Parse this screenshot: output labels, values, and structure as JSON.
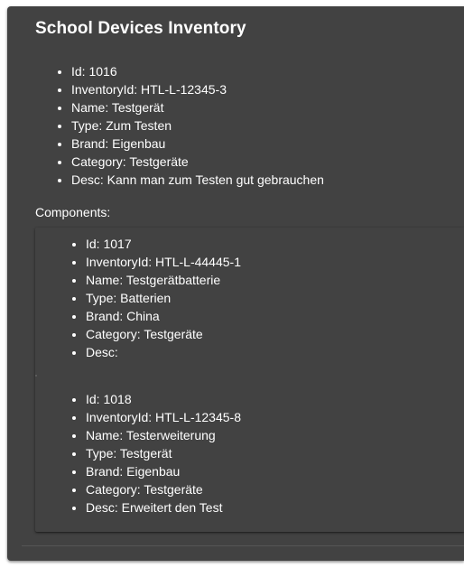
{
  "title": "School Devices Inventory",
  "device": {
    "fields": [
      "Id: 1016",
      "InventoryId: HTL-L-12345-3",
      "Name: Testgerät",
      "Type: Zum Testen",
      "Brand: Eigenbau",
      "Category: Testgeräte",
      "Desc: Kann man zum Testen gut gebrauchen"
    ]
  },
  "components_label": "Components:",
  "components": [
    {
      "fields": [
        "Id: 1017",
        "InventoryId: HTL-L-44445-1",
        "Name: Testgerätbatterie",
        "Type: Batterien",
        "Brand: China",
        "Category: Testgeräte",
        "Desc:"
      ]
    },
    {
      "fields": [
        "Id: 1018",
        "InventoryId: HTL-L-12345-8",
        "Name: Testerweiterung",
        "Type: Testgerät",
        "Brand: Eigenbau",
        "Category: Testgeräte",
        "Desc: Erweitert den Test"
      ]
    }
  ],
  "colors": {
    "card_background": "#424242",
    "text": "#ffffff",
    "page_background": "#ffffff"
  }
}
